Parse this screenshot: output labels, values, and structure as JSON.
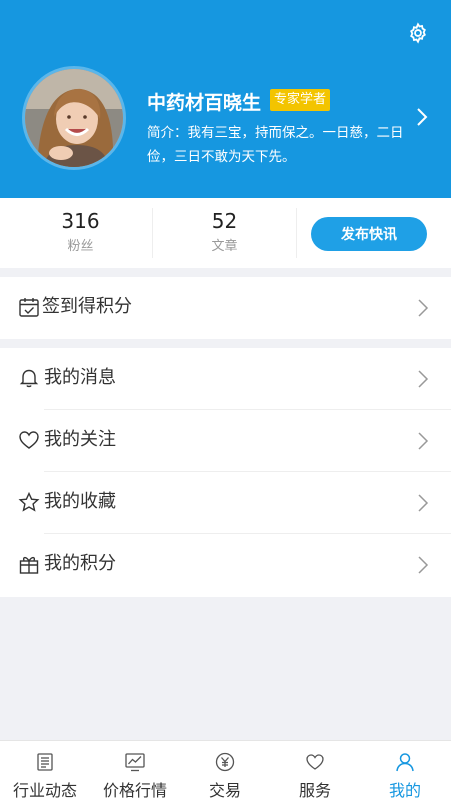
{
  "profile": {
    "name": "中药材百晓生",
    "badge": "专家学者",
    "bio": "简介：我有三宝，持而保之。一日慈，二日俭，三日不敢为天下先。"
  },
  "stats": {
    "fans_count": "316",
    "fans_label": "粉丝",
    "articles_count": "52",
    "articles_label": "文章",
    "publish_label": "发布快讯"
  },
  "menu": {
    "checkin": "签到得积分",
    "items": [
      {
        "label": "我的消息",
        "icon": "bell-icon"
      },
      {
        "label": "我的关注",
        "icon": "heart-icon"
      },
      {
        "label": "我的收藏",
        "icon": "star-icon"
      },
      {
        "label": "我的积分",
        "icon": "gift-icon"
      }
    ]
  },
  "tabbar": {
    "tabs": [
      {
        "label": "行业动态",
        "icon": "news-icon"
      },
      {
        "label": "价格行情",
        "icon": "chart-icon"
      },
      {
        "label": "交易",
        "icon": "yuan-icon"
      },
      {
        "label": "服务",
        "icon": "heart-icon"
      },
      {
        "label": "我的",
        "icon": "user-icon"
      }
    ],
    "active_index": 4
  },
  "colors": {
    "primary": "#1697e0",
    "badge": "#f3c400",
    "background": "#f0f1f5"
  }
}
